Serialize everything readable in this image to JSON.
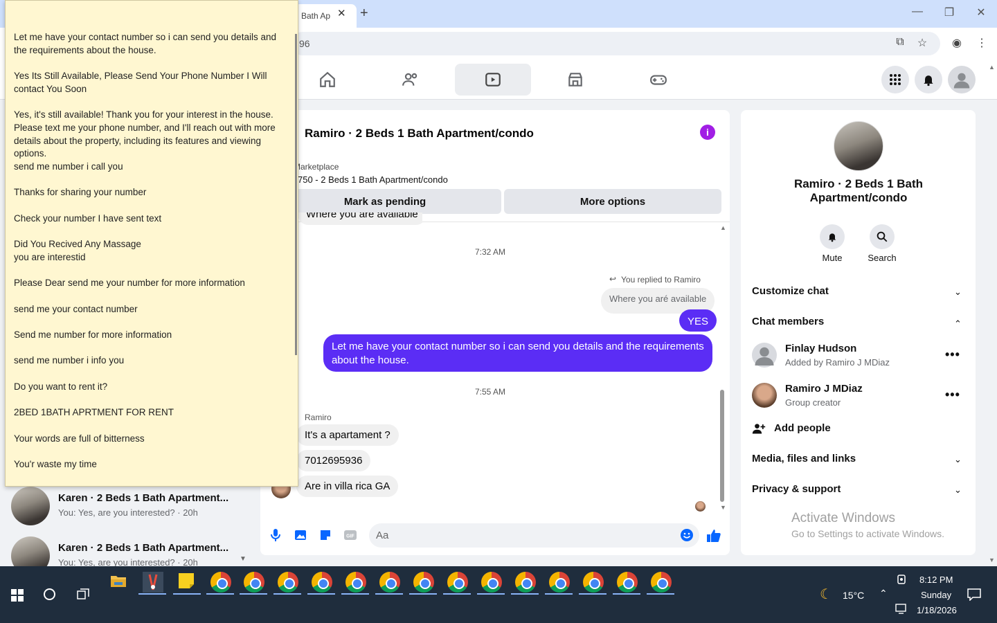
{
  "browser": {
    "tab_label": "Bath Ap",
    "url_fragment": "96"
  },
  "chat": {
    "title": "Ramiro · 2 Beds 1 Bath Apartment/condo",
    "marketplace_label": "Marketplace",
    "listing_price": "750 - 2 Beds 1 Bath Apartment/condo",
    "mark_pending": "Mark as pending",
    "more_options": "More options",
    "partial_message": "Where you are available",
    "time1": "7:32 AM",
    "replied_to": "You replied to Ramiro",
    "quoted": "Where you aré available",
    "yes": "YES",
    "out_message": "Let me have your contact number so i can send you details and the requirements about the house.",
    "time2": "7:55 AM",
    "sender": "Ramiro",
    "in1": "It's a apartament ?",
    "in2": "7012695936",
    "in3": "Are in villa rica GA",
    "composer_placeholder": "Aa"
  },
  "right_panel": {
    "name": "Ramiro · 2 Beds 1 Bath Apartment/condo",
    "mute": "Mute",
    "search": "Search",
    "customize": "Customize chat",
    "members_heading": "Chat members",
    "member1_name": "Finlay Hudson",
    "member1_sub": "Added by Ramiro J MDiaz",
    "member2_name": "Ramiro J MDiaz",
    "member2_sub": "Group creator",
    "add_people": "Add people",
    "media": "Media, files and links",
    "privacy": "Privacy & support",
    "activate_title": "Activate Windows",
    "activate_sub": "Go to Settings to activate Windows."
  },
  "chat_list": [
    {
      "title": "Karen · 2 Beds 1 Bath Apartment...",
      "sub": "You: Yes, are you interested? · 20h"
    },
    {
      "title": "Karen · 2 Beds 1 Bath Apartment...",
      "sub": "You: Yes, are you interested? · 20h"
    }
  ],
  "note": {
    "lines": [
      "Let me have your contact number so i can send you details and the requirements about the house.",
      "Yes Its Still Available, Please Send Your Phone Number I Will contact You Soon",
      "Yes, it's still available! Thank you for your interest in the house. Please text me your phone number, and I'll reach out with more details about the property, including its features and viewing options.",
      "send me number i call you",
      "Thanks for sharing your number",
      "Check your number I have sent text",
      "Did You Recived Any Massage",
      "you are interestid",
      "Please Dear send me your number for more information",
      "send me your contact number",
      "Send me number for more information",
      "send me number i info you",
      "Do you want to rent it?",
      "2BED 1BATH APRTMENT FOR RENT",
      "Your words are full of bitterness",
      "You'r waste my time"
    ]
  },
  "taskbar": {
    "weather": "15°C",
    "time": "8:12 PM",
    "day": "Sunday",
    "date": "1/18/2026"
  }
}
